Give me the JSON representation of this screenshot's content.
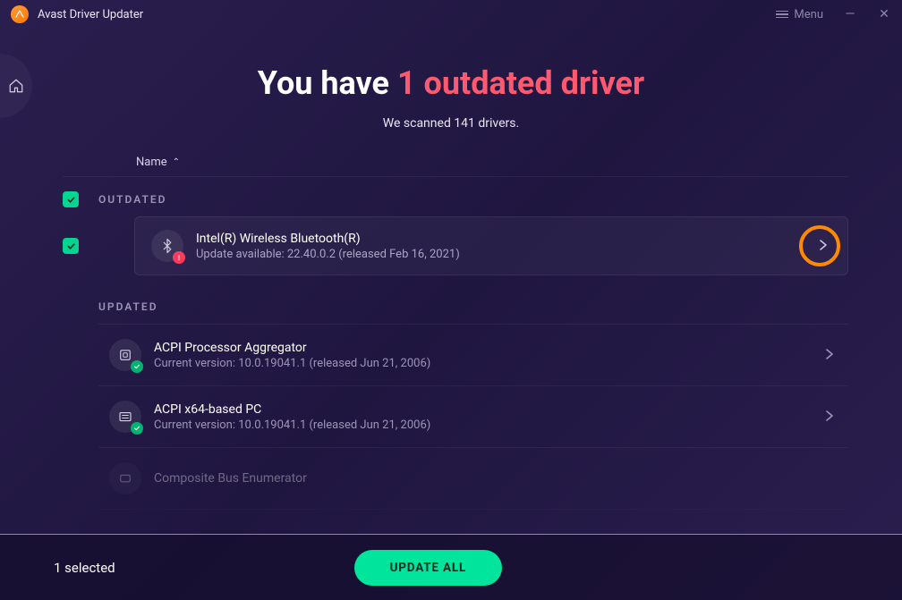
{
  "titlebar": {
    "app_name": "Avast Driver Updater",
    "menu_label": "Menu"
  },
  "headline": {
    "prefix": "You have ",
    "highlight": "1 outdated driver"
  },
  "subhead": "We scanned 141 drivers.",
  "columns": {
    "name": "Name"
  },
  "sections": {
    "outdated": "OUTDATED",
    "updated": "UPDATED"
  },
  "outdated_driver": {
    "name": "Intel(R) Wireless Bluetooth(R)",
    "detail": "Update available: 22.40.0.2 (released Feb 16, 2021)"
  },
  "updated_drivers": [
    {
      "name": "ACPI Processor Aggregator",
      "detail": "Current version: 10.0.19041.1 (released Jun 21, 2006)"
    },
    {
      "name": "ACPI x64-based PC",
      "detail": "Current version: 10.0.19041.1 (released Jun 21, 2006)"
    },
    {
      "name": "Composite Bus Enumerator",
      "detail": ""
    }
  ],
  "footer": {
    "selected": "1 selected",
    "button": "UPDATE ALL"
  }
}
